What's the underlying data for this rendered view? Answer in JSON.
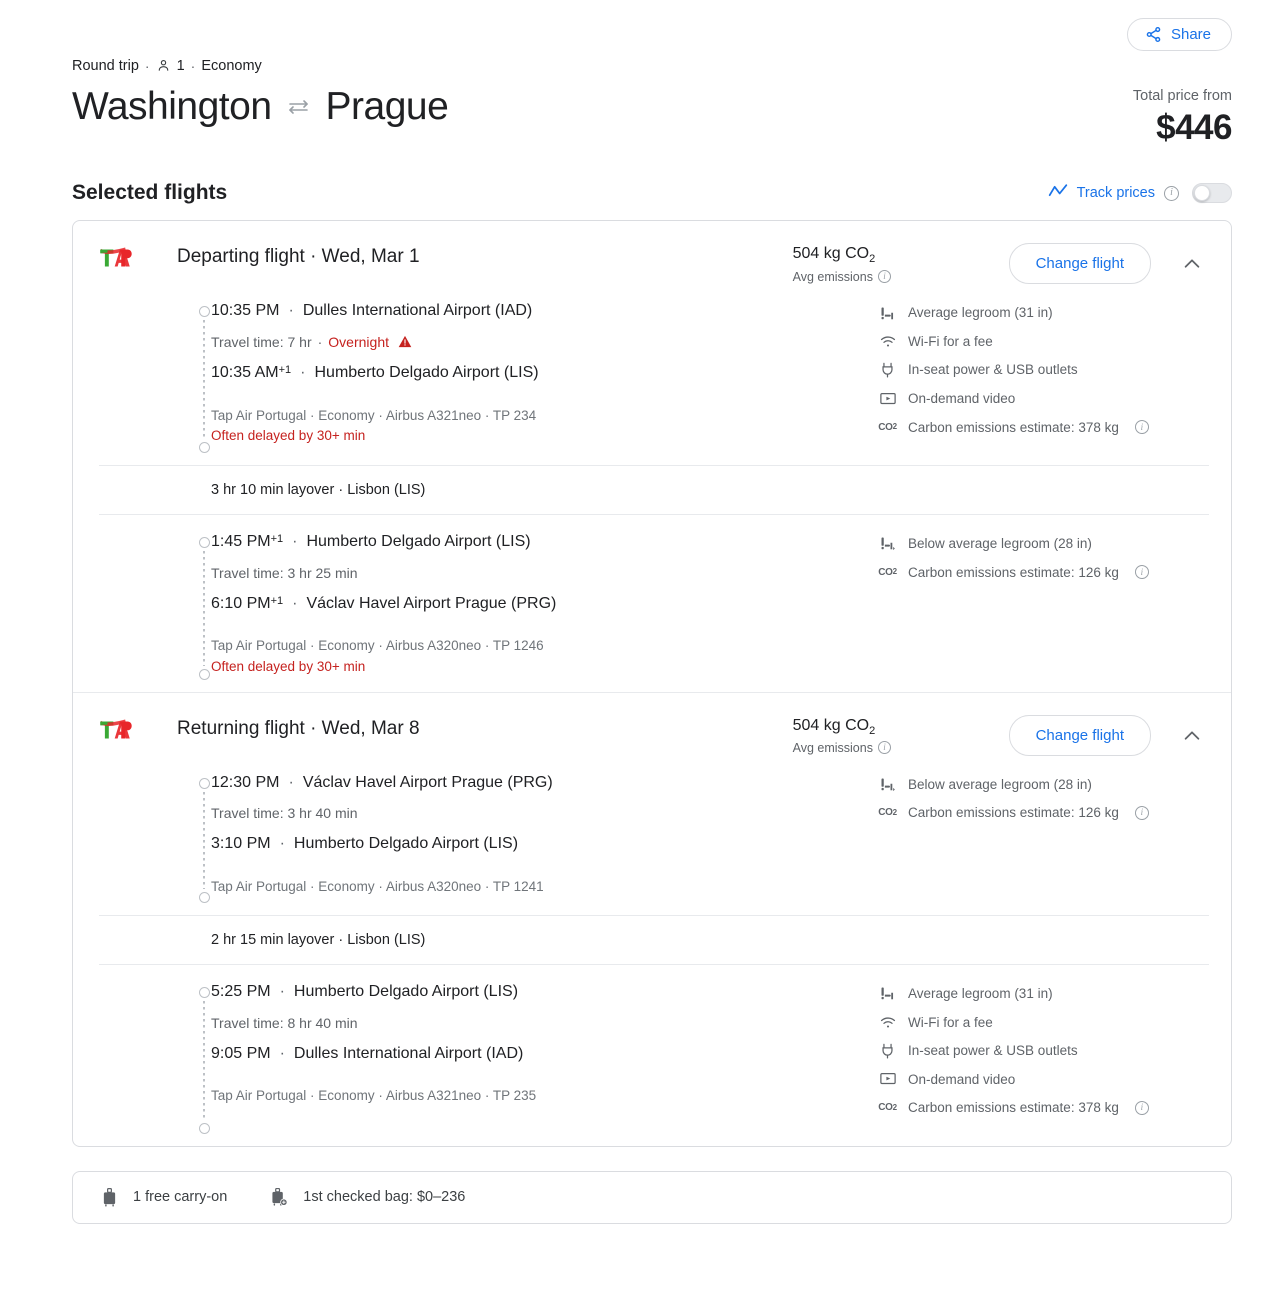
{
  "header": {
    "share_label": "Share",
    "trip_type": "Round trip",
    "passengers": "1",
    "cabin": "Economy",
    "origin": "Washington",
    "destination": "Prague",
    "swap_icon": "swap-arrows-icon",
    "price_label": "Total price from",
    "price_value": "$446"
  },
  "selected": {
    "title": "Selected flights",
    "track_label": "Track prices",
    "track_enabled": false
  },
  "legs": [
    {
      "airline_logo": "tap-air-portugal-logo",
      "title": "Departing flight · Wed, Mar 1",
      "co2_amount": "504 kg CO",
      "co2_sub": "2",
      "co2_note": "Avg emissions",
      "change_label": "Change flight",
      "collapse_icon": "chevron-up-icon",
      "segments": [
        {
          "depart_time": "10:35 PM",
          "depart_plus": "",
          "depart_place": "Dulles International Airport (IAD)",
          "travel_time": "Travel time: 7 hr",
          "overnight": "Overnight",
          "has_warning": true,
          "arrive_time": "10:35 AM",
          "arrive_plus": "+1",
          "arrive_place": "Humberto Delgado Airport (LIS)",
          "meta": "Tap Air Portugal · Economy · Airbus A321neo · TP 234",
          "delay": "Often delayed by 30+ min",
          "amenities": [
            {
              "icon": "legroom-icon",
              "label": "Average legroom (31 in)",
              "info": false
            },
            {
              "icon": "wifi-icon",
              "label": "Wi-Fi for a fee",
              "info": false
            },
            {
              "icon": "power-outlet-icon",
              "label": "In-seat power & USB outlets",
              "info": false
            },
            {
              "icon": "video-icon",
              "label": "On-demand video",
              "info": false
            },
            {
              "icon": "co2-icon",
              "label": "Carbon emissions estimate: 378 kg",
              "info": true
            }
          ]
        },
        {
          "depart_time": "1:45 PM",
          "depart_plus": "+1",
          "depart_place": "Humberto Delgado Airport (LIS)",
          "travel_time": "Travel time: 3 hr 25 min",
          "overnight": "",
          "has_warning": false,
          "arrive_time": "6:10 PM",
          "arrive_plus": "+1",
          "arrive_place": "Václav Havel Airport Prague (PRG)",
          "meta": "Tap Air Portugal · Economy · Airbus A320neo · TP 1246",
          "delay": "Often delayed by 30+ min",
          "amenities": [
            {
              "icon": "legroom-reduced-icon",
              "label": "Below average legroom (28 in)",
              "info": false
            },
            {
              "icon": "co2-icon",
              "label": "Carbon emissions estimate: 126 kg",
              "info": true
            }
          ]
        }
      ],
      "layover": "3 hr 10 min layover · Lisbon (LIS)"
    },
    {
      "airline_logo": "tap-air-portugal-logo",
      "title": "Returning flight · Wed, Mar 8",
      "co2_amount": "504 kg CO",
      "co2_sub": "2",
      "co2_note": "Avg emissions",
      "change_label": "Change flight",
      "collapse_icon": "chevron-up-icon",
      "segments": [
        {
          "depart_time": "12:30 PM",
          "depart_plus": "",
          "depart_place": "Václav Havel Airport Prague (PRG)",
          "travel_time": "Travel time: 3 hr 40 min",
          "overnight": "",
          "has_warning": false,
          "arrive_time": "3:10 PM",
          "arrive_plus": "",
          "arrive_place": "Humberto Delgado Airport (LIS)",
          "meta": "Tap Air Portugal · Economy · Airbus A320neo · TP 1241",
          "delay": "",
          "amenities": [
            {
              "icon": "legroom-reduced-icon",
              "label": "Below average legroom (28 in)",
              "info": false
            },
            {
              "icon": "co2-icon",
              "label": "Carbon emissions estimate: 126 kg",
              "info": true
            }
          ]
        },
        {
          "depart_time": "5:25 PM",
          "depart_plus": "",
          "depart_place": "Humberto Delgado Airport (LIS)",
          "travel_time": "Travel time: 8 hr 40 min",
          "overnight": "",
          "has_warning": false,
          "arrive_time": "9:05 PM",
          "arrive_plus": "",
          "arrive_place": "Dulles International Airport (IAD)",
          "meta": "Tap Air Portugal · Economy · Airbus A321neo · TP 235",
          "delay": "",
          "amenities": [
            {
              "icon": "legroom-icon",
              "label": "Average legroom (31 in)",
              "info": false
            },
            {
              "icon": "wifi-icon",
              "label": "Wi-Fi for a fee",
              "info": false
            },
            {
              "icon": "power-outlet-icon",
              "label": "In-seat power & USB outlets",
              "info": false
            },
            {
              "icon": "video-icon",
              "label": "On-demand video",
              "info": false
            },
            {
              "icon": "co2-icon",
              "label": "Carbon emissions estimate: 378 kg",
              "info": true
            }
          ]
        }
      ],
      "layover": "2 hr 15 min layover · Lisbon (LIS)"
    }
  ],
  "bags": [
    {
      "icon": "carry-on-bag-icon",
      "label": "1 free carry-on"
    },
    {
      "icon": "checked-bag-icon",
      "label": "1st checked bag: $0–236"
    }
  ],
  "colors": {
    "accent": "#1a73e8",
    "alert": "#c5221f",
    "muted": "#5f6368",
    "border": "#dadce0"
  }
}
